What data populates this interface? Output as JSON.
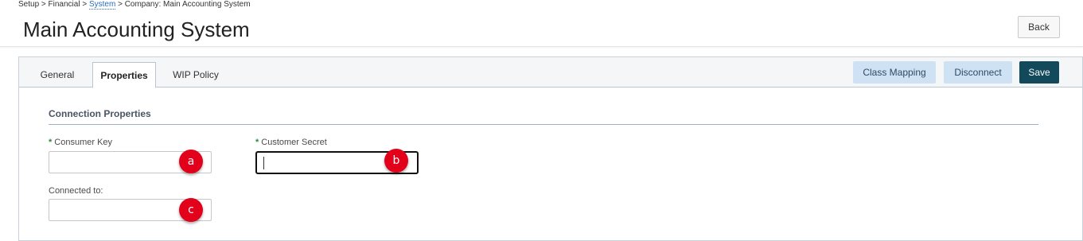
{
  "breadcrumb": {
    "part1": "Setup > Financial > ",
    "link": "System",
    "part2": " > Company: Main Accounting System"
  },
  "header": {
    "title": "Main Accounting System",
    "back_label": "Back"
  },
  "tabs": [
    {
      "label": "General"
    },
    {
      "label": "Properties"
    },
    {
      "label": "WIP Policy"
    }
  ],
  "active_tab": "Properties",
  "actions": {
    "class_mapping": "Class Mapping",
    "disconnect": "Disconnect",
    "save": "Save"
  },
  "section": {
    "title": "Connection Properties"
  },
  "fields": {
    "required_mark": "*",
    "consumer_key": {
      "label": "Consumer Key",
      "value": ""
    },
    "customer_secret": {
      "label": "Customer Secret",
      "value": ""
    },
    "connected_to": {
      "label": "Connected to:",
      "value": ""
    }
  },
  "markers": [
    "a",
    "b",
    "c"
  ],
  "colors": {
    "accent_dark": "#124a5c",
    "accent_light": "#cfe2f3",
    "required": "#2e8b3c",
    "marker": "#e3001b"
  }
}
